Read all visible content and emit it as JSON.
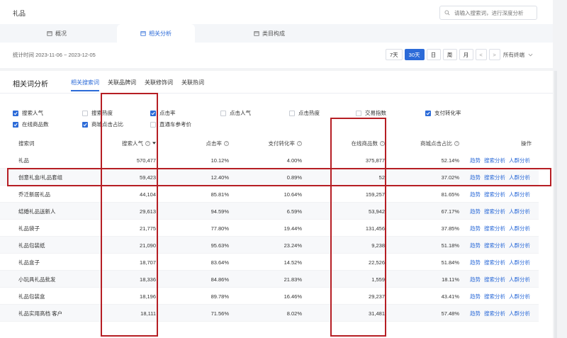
{
  "header": {
    "title": "礼品",
    "search_placeholder": "请输入搜索词，进行深度分析",
    "tabs": [
      {
        "label": "概况",
        "icon": "calendar-icon"
      },
      {
        "label": "相关分析",
        "icon": "calendar-icon"
      },
      {
        "label": "类目构成",
        "icon": "calendar-icon"
      }
    ],
    "active_tab": "相关分析"
  },
  "filters": {
    "stats_time": "统计时间 2023-11-06 ~ 2023-12-05",
    "ranges": [
      "7天",
      "30天",
      "日",
      "周",
      "月"
    ],
    "active_range": "30天",
    "prev": "<",
    "next": ">",
    "terminal": "所有终端"
  },
  "panel": {
    "title": "相关词分析",
    "tabs": [
      "相关搜索词",
      "关联品牌词",
      "关联修饰词",
      "关联热词"
    ],
    "active_tab": "相关搜索词"
  },
  "checkboxes": [
    {
      "label": "搜索人气",
      "checked": true
    },
    {
      "label": "搜索热度",
      "checked": false
    },
    {
      "label": "点击率",
      "checked": true
    },
    {
      "label": "点击人气",
      "checked": false
    },
    {
      "label": "点击热度",
      "checked": false
    },
    {
      "label": "交易指数",
      "checked": false
    },
    {
      "label": "支付转化率",
      "checked": true
    },
    {
      "label": "在线商品数",
      "checked": true
    },
    {
      "label": "商城点击占比",
      "checked": true
    },
    {
      "label": "直通车参考价",
      "checked": false
    }
  ],
  "table": {
    "headers": [
      "搜索词",
      "搜索人气",
      "点击率",
      "支付转化率",
      "在线商品数",
      "商城点击占比",
      "操作"
    ],
    "rows": [
      [
        "礼品",
        "570,477",
        "10.12%",
        "4.00%",
        "375,877",
        "52.14%"
      ],
      [
        "创意礼盒/礼品套组",
        "59,423",
        "12.40%",
        "0.89%",
        "52",
        "37.02%"
      ],
      [
        "乔迁新居礼品",
        "44,104",
        "85.81%",
        "10.64%",
        "159,257",
        "81.65%"
      ],
      [
        "结婚礼品送新人",
        "29,613",
        "94.59%",
        "6.59%",
        "53,942",
        "67.17%"
      ],
      [
        "礼品袋子",
        "21,775",
        "77.80%",
        "19.44%",
        "131,456",
        "37.85%"
      ],
      [
        "礼品包装纸",
        "21,090",
        "95.63%",
        "23.24%",
        "9,238",
        "51.18%"
      ],
      [
        "礼品盒子",
        "18,707",
        "83.64%",
        "14.52%",
        "22,526",
        "51.84%"
      ],
      [
        "小玩具礼品批发",
        "18,336",
        "84.86%",
        "21.83%",
        "1,559",
        "18.11%"
      ],
      [
        "礼品包装盒",
        "18,196",
        "89.78%",
        "16.46%",
        "29,237",
        "43.41%"
      ],
      [
        "礼品实用高档 客户",
        "18,111",
        "71.56%",
        "8.02%",
        "31,481",
        "57.48%"
      ]
    ],
    "actions": [
      "趋势",
      "搜索分析",
      "人群分析"
    ]
  },
  "colors": {
    "accent": "#2c6bd8",
    "highlight": "#b61e24"
  }
}
